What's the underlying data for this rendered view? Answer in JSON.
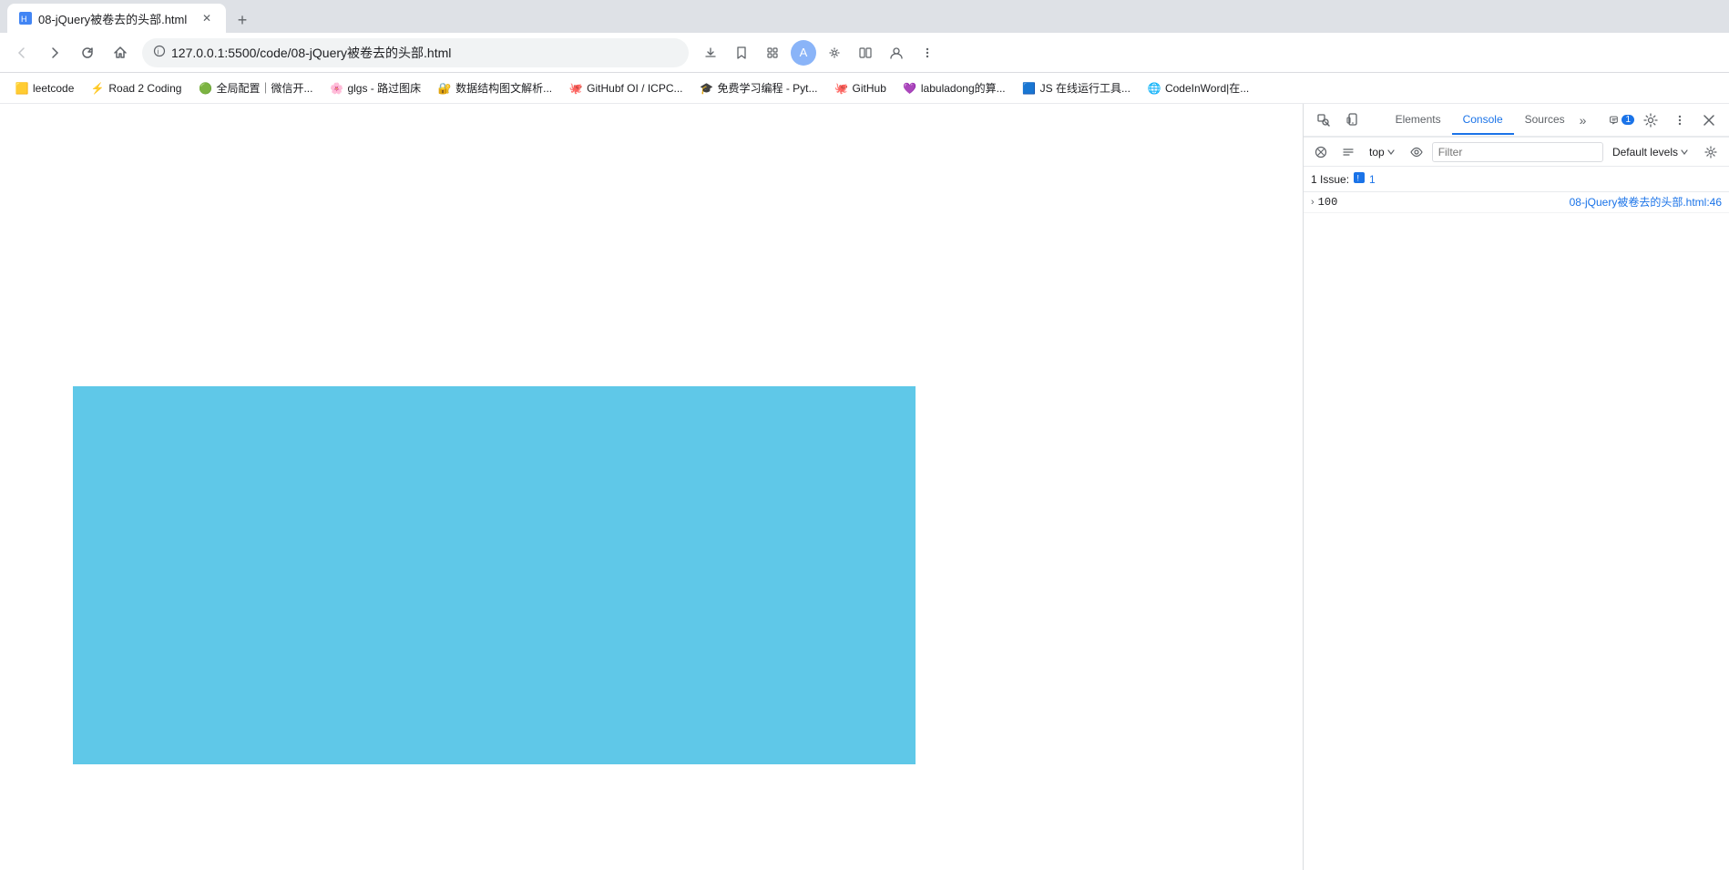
{
  "browser": {
    "tab": {
      "title": "08-jQuery被卷去的头部.html",
      "favicon": "📄"
    },
    "address": "127.0.0.1:5500/code/08-jQuery被卷去的头部.html",
    "new_tab_label": "+",
    "back_tooltip": "Back",
    "forward_tooltip": "Forward",
    "refresh_tooltip": "Refresh",
    "home_tooltip": "Home"
  },
  "bookmarks": [
    {
      "id": "leetcode",
      "label": "leetcode",
      "icon": "🟨"
    },
    {
      "id": "road2coding",
      "label": "Road 2 Coding",
      "icon": "⚡"
    },
    {
      "id": "wechat",
      "label": "全局配置｜微信开...",
      "icon": "🟢"
    },
    {
      "id": "glgs",
      "label": "glgs - 路过图床",
      "icon": "🌸"
    },
    {
      "id": "data-struct",
      "label": "数据结构图文解析...",
      "icon": "🔐"
    },
    {
      "id": "github-oi",
      "label": "GitHubf OI / ICPC...",
      "icon": "🐙"
    },
    {
      "id": "free-learn",
      "label": "免费学习编程 - Pyt...",
      "icon": "🎓"
    },
    {
      "id": "github",
      "label": "GitHub",
      "icon": "🐙"
    },
    {
      "id": "labuladong",
      "label": "labuladong的算...",
      "icon": "💜"
    },
    {
      "id": "js-tool",
      "label": "JS 在线运行工具...",
      "icon": "🟦"
    },
    {
      "id": "codeinword",
      "label": "CodeInWord|在...",
      "icon": "🌐"
    }
  ],
  "devtools": {
    "tabs": [
      "Elements",
      "Console",
      "Sources"
    ],
    "active_tab": "Console",
    "more_tabs_label": "»",
    "toolbar": {
      "top_label": "top",
      "filter_placeholder": "Filter",
      "levels_label": "Default levels",
      "clear_tooltip": "Clear console",
      "settings_tooltip": "Console settings"
    },
    "issues": {
      "label": "1 Issue:",
      "count": "1",
      "icon": "🔵"
    },
    "console_entries": [
      {
        "value": "100",
        "source": "08-jQuery被卷去的头部.html:46",
        "has_expand": true,
        "expand_char": "›"
      }
    ]
  },
  "webpage": {
    "blue_box_color": "#5fc8e8"
  }
}
